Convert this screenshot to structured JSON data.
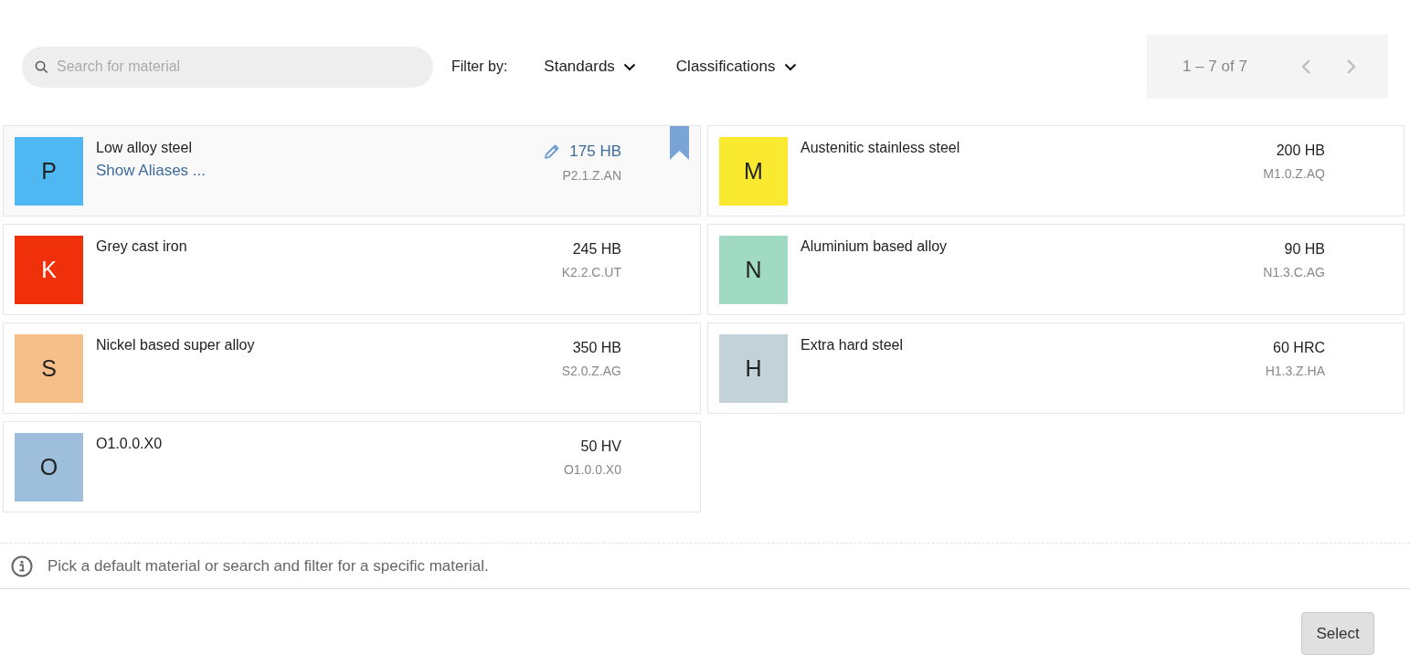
{
  "search": {
    "placeholder": "Search for material"
  },
  "filter": {
    "label": "Filter by:",
    "dropdowns": [
      "Standards",
      "Classifications"
    ]
  },
  "pagination": {
    "range": "1 – 7 of 7"
  },
  "materials": [
    {
      "letter": "P",
      "color": "#4fb8f2",
      "name": "Low alloy steel",
      "aliases_link": "Show Aliases ...",
      "hardness": "175 HB",
      "code": "P2.1.Z.AN",
      "selected": true
    },
    {
      "letter": "M",
      "color": "#f9e930",
      "name": "Austenitic stainless steel",
      "hardness": "200 HB",
      "code": "M1.0.Z.AQ",
      "selected": false
    },
    {
      "letter": "K",
      "color": "#f0300a",
      "name": "Grey cast iron",
      "hardness": "245 HB",
      "code": "K2.2.C.UT",
      "selected": false
    },
    {
      "letter": "N",
      "color": "#a1dac3",
      "name": "Aluminium based alloy",
      "hardness": "90 HB",
      "code": "N1.3.C.AG",
      "selected": false
    },
    {
      "letter": "S",
      "color": "#f6bf89",
      "name": "Nickel based super alloy",
      "hardness": "350 HB",
      "code": "S2.0.Z.AG",
      "selected": false
    },
    {
      "letter": "H",
      "color": "#c3d1d9",
      "name": "Extra hard steel",
      "hardness": "60 HRC",
      "code": "H1.3.Z.HA",
      "selected": false
    },
    {
      "letter": "O",
      "color": "#9dbfdc",
      "name": "O1.0.0.X0",
      "hardness": "50 HV",
      "code": "O1.0.0.X0",
      "selected": false
    }
  ],
  "info": {
    "message": "Pick a default material or search and filter for a specific material."
  },
  "buttons": [
    "Select"
  ]
}
